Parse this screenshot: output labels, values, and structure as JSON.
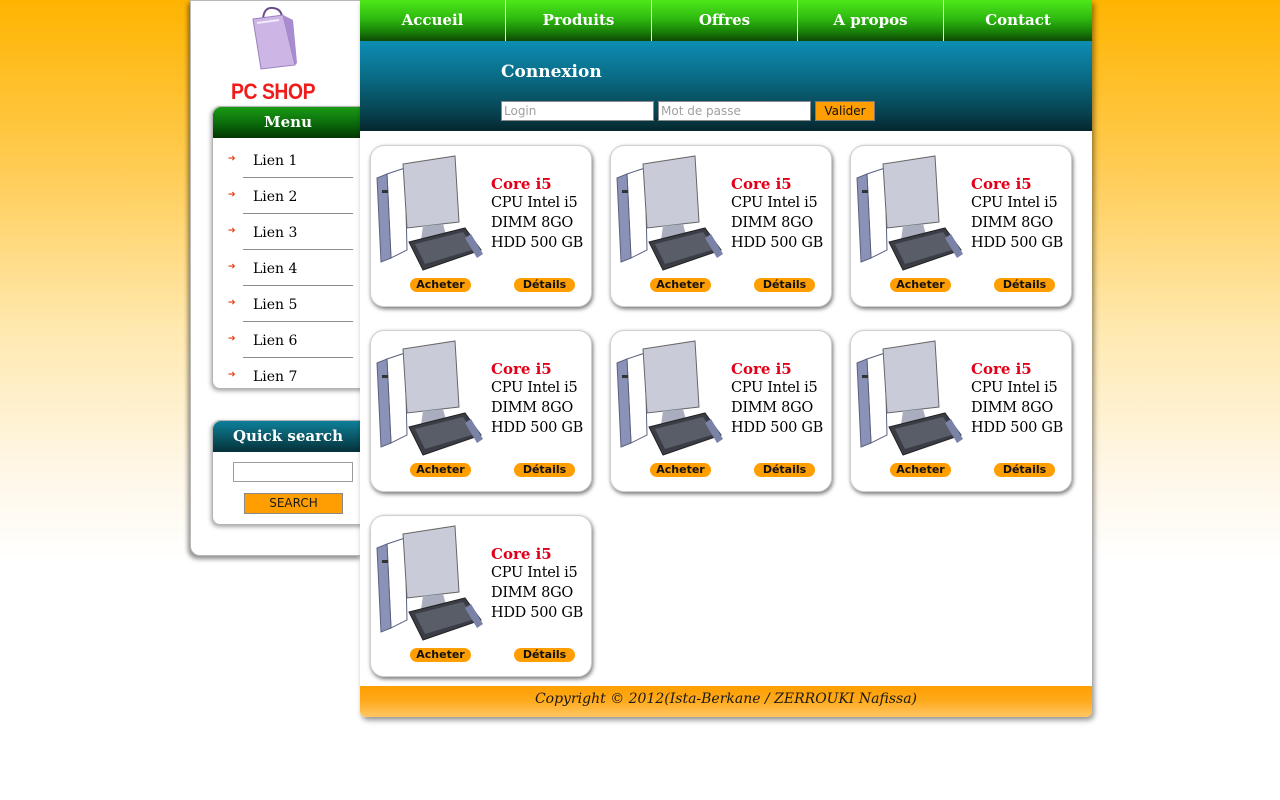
{
  "logo": {
    "text": "PC SHOP",
    "icon": "shopping-bag-icon"
  },
  "nav": [
    {
      "label": "Accueil"
    },
    {
      "label": "Produits"
    },
    {
      "label": "Offres"
    },
    {
      "label": "A propos"
    },
    {
      "label": "Contact"
    }
  ],
  "login": {
    "title": "Connexion",
    "user_placeholder": "Login",
    "pass_placeholder": "Mot de passe",
    "submit_label": "Valider"
  },
  "menu": {
    "title": "Menu",
    "items": [
      {
        "label": "Lien 1"
      },
      {
        "label": "Lien 2"
      },
      {
        "label": "Lien 3"
      },
      {
        "label": "Lien 4"
      },
      {
        "label": "Lien 5"
      },
      {
        "label": "Lien 6"
      },
      {
        "label": "Lien 7"
      }
    ]
  },
  "search": {
    "title": "Quick search",
    "value": "",
    "button_label": "SEARCH"
  },
  "products": [
    {
      "title": "Core i5",
      "specs": [
        "CPU Intel i5",
        "DIMM 8GO",
        "HDD 500 GB"
      ],
      "buy_label": "Acheter",
      "details_label": "Détails"
    },
    {
      "title": "Core i5",
      "specs": [
        "CPU Intel i5",
        "DIMM 8GO",
        "HDD 500 GB"
      ],
      "buy_label": "Acheter",
      "details_label": "Détails"
    },
    {
      "title": "Core i5",
      "specs": [
        "CPU Intel i5",
        "DIMM 8GO",
        "HDD 500 GB"
      ],
      "buy_label": "Acheter",
      "details_label": "Détails"
    },
    {
      "title": "Core i5",
      "specs": [
        "CPU Intel i5",
        "DIMM 8GO",
        "HDD 500 GB"
      ],
      "buy_label": "Acheter",
      "details_label": "Détails"
    },
    {
      "title": "Core i5",
      "specs": [
        "CPU Intel i5",
        "DIMM 8GO",
        "HDD 500 GB"
      ],
      "buy_label": "Acheter",
      "details_label": "Détails"
    },
    {
      "title": "Core i5",
      "specs": [
        "CPU Intel i5",
        "DIMM 8GO",
        "HDD 500 GB"
      ],
      "buy_label": "Acheter",
      "details_label": "Détails"
    },
    {
      "title": "Core i5",
      "specs": [
        "CPU Intel i5",
        "DIMM 8GO",
        "HDD 500 GB"
      ],
      "buy_label": "Acheter",
      "details_label": "Détails"
    }
  ],
  "product_image_icon": "desktop-computer-icon",
  "footer": {
    "text": "Copyright © 2012(Ista-Berkane / ZERROUKI Nafissa)"
  },
  "colors": {
    "accent_orange": "#ff9e00",
    "nav_green": "#2fba10",
    "login_teal": "#0a6c86",
    "product_title_red": "#e0001a",
    "logo_red": "#ef1c1c"
  }
}
